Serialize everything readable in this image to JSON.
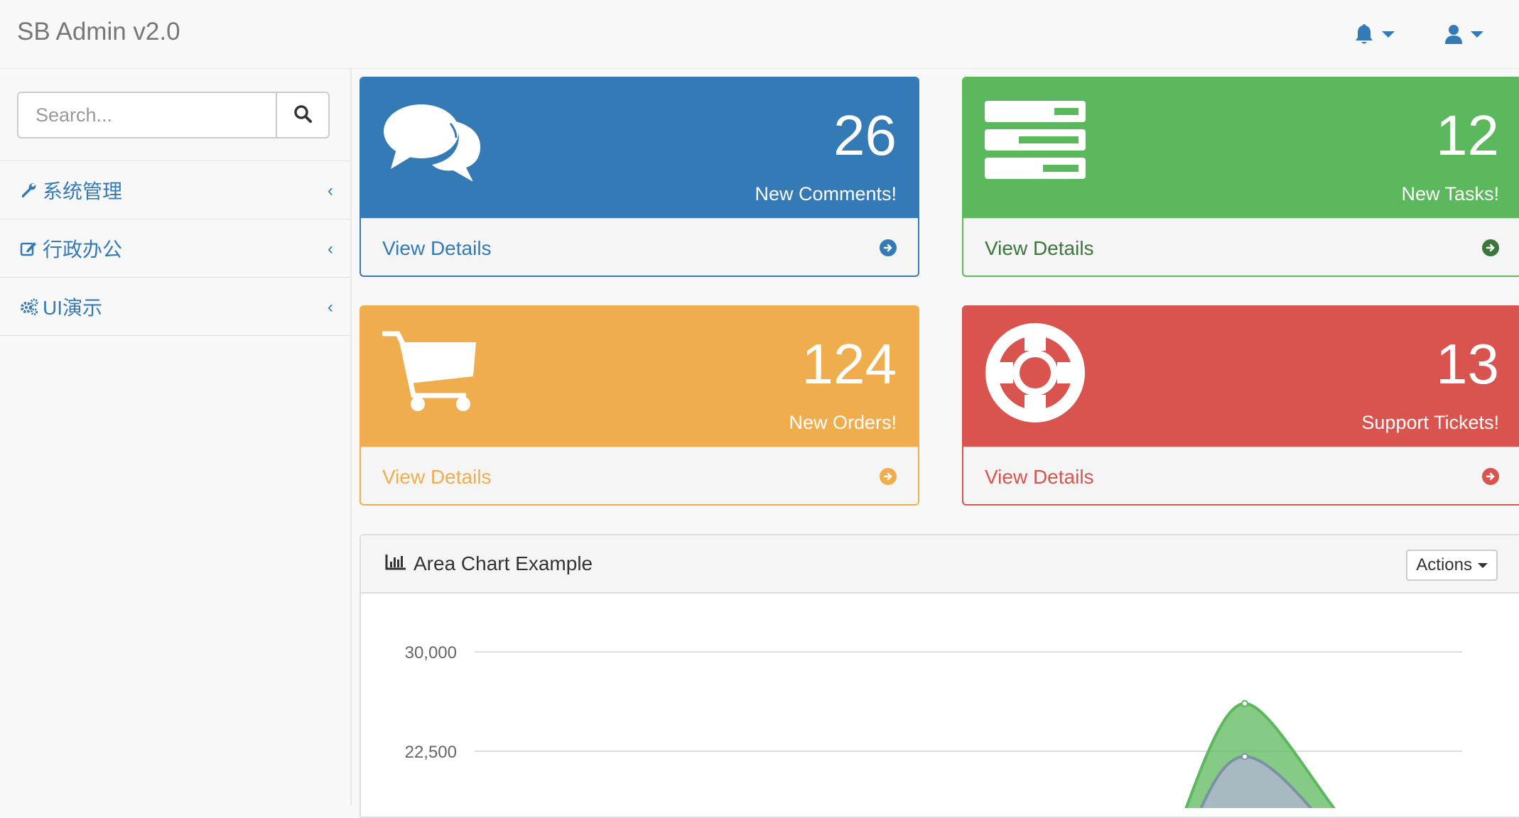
{
  "navbar": {
    "brand": "SB Admin v2.0",
    "alerts_icon": "bell-icon",
    "user_icon": "user-icon"
  },
  "sidebar": {
    "search": {
      "placeholder": "Search...",
      "value": ""
    },
    "items": [
      {
        "label": "系统管理",
        "icon": "wrench-icon"
      },
      {
        "label": "行政办公",
        "icon": "edit-icon"
      },
      {
        "label": "UI演示",
        "icon": "gears-icon"
      }
    ]
  },
  "panels": [
    {
      "number": "26",
      "label": "New Comments!",
      "link": "View Details",
      "icon": "comments-icon",
      "color": "#337ab7"
    },
    {
      "number": "12",
      "label": "New Tasks!",
      "link": "View Details",
      "icon": "tasks-icon",
      "color": "#5cb85c"
    },
    {
      "number": "124",
      "label": "New Orders!",
      "link": "View Details",
      "icon": "shopping-cart-icon",
      "color": "#f0ad4e"
    },
    {
      "number": "13",
      "label": "Support Tickets!",
      "link": "View Details",
      "icon": "support-icon",
      "color": "#d9534f"
    }
  ],
  "chart_panel": {
    "title": "Area Chart Example",
    "actions_label": "Actions",
    "icon": "bar-chart-icon"
  },
  "chart_data": {
    "type": "area",
    "title": "Area Chart Example",
    "y_ticks": [
      "30,000",
      "22,500"
    ],
    "ylim_visible": [
      22500,
      30000
    ],
    "grid": true,
    "series": [
      {
        "color": "#5cb85c",
        "visible_peak": 26100
      },
      {
        "color": "#7a92a3",
        "visible_peak": 22100
      }
    ]
  }
}
